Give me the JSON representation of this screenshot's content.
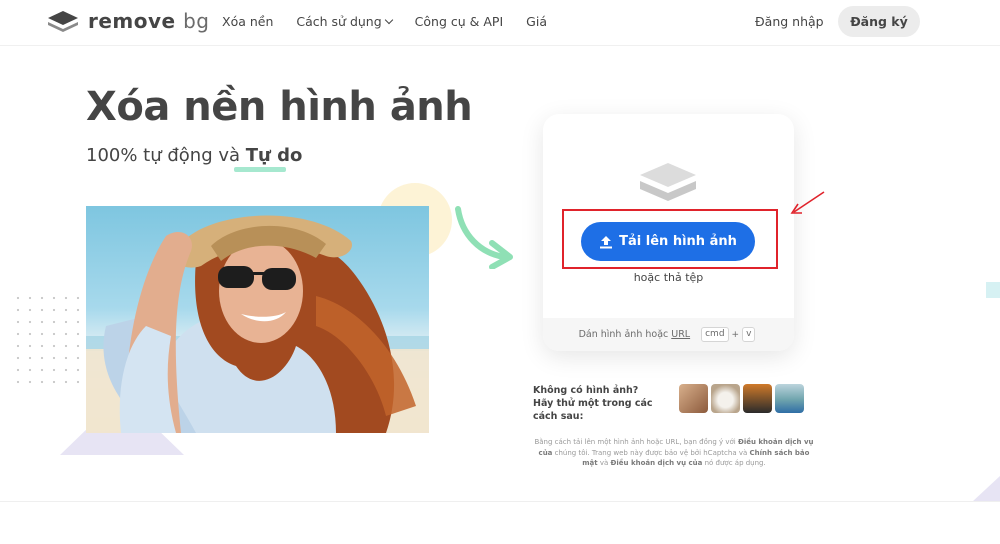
{
  "nav": {
    "logo_text": "remove",
    "logo_text_bg": "bg",
    "links": [
      "Xóa nền",
      "Cách sử dụng",
      "Công cụ & API",
      "Giá"
    ],
    "login": "Đăng nhập",
    "signup": "Đăng ký"
  },
  "hero": {
    "title": "Xóa nền hình ảnh",
    "subtitle_prefix": "100% tự động và ",
    "subtitle_bold": "Tự do"
  },
  "upload": {
    "button_label": "Tải lên hình ảnh",
    "drop_text": "hoặc thả tệp",
    "paste_text": "Dán hình ảnh hoặc",
    "paste_url": "URL",
    "key_cmd": "cmd",
    "key_plus": "+",
    "key_v": "v"
  },
  "samples": {
    "line1": "Không có hình ảnh?",
    "line2": "Hãy thử một trong các cách sau:"
  },
  "legal": {
    "t1": "Bằng cách tải lên một hình ảnh hoặc URL, bạn đồng ý với ",
    "l1": "Điều khoản dịch vụ của",
    "t2": " chúng tôi. Trang web này được bảo vệ bởi hCaptcha và ",
    "l2": "Chính sách bảo mật",
    "t3": " và ",
    "l3": "Điều khoản dịch vụ của",
    "t4": " nó được áp dụng."
  },
  "colors": {
    "accent": "#1e6fe6",
    "highlight": "#e0232b",
    "underline": "#a6e8cf"
  }
}
